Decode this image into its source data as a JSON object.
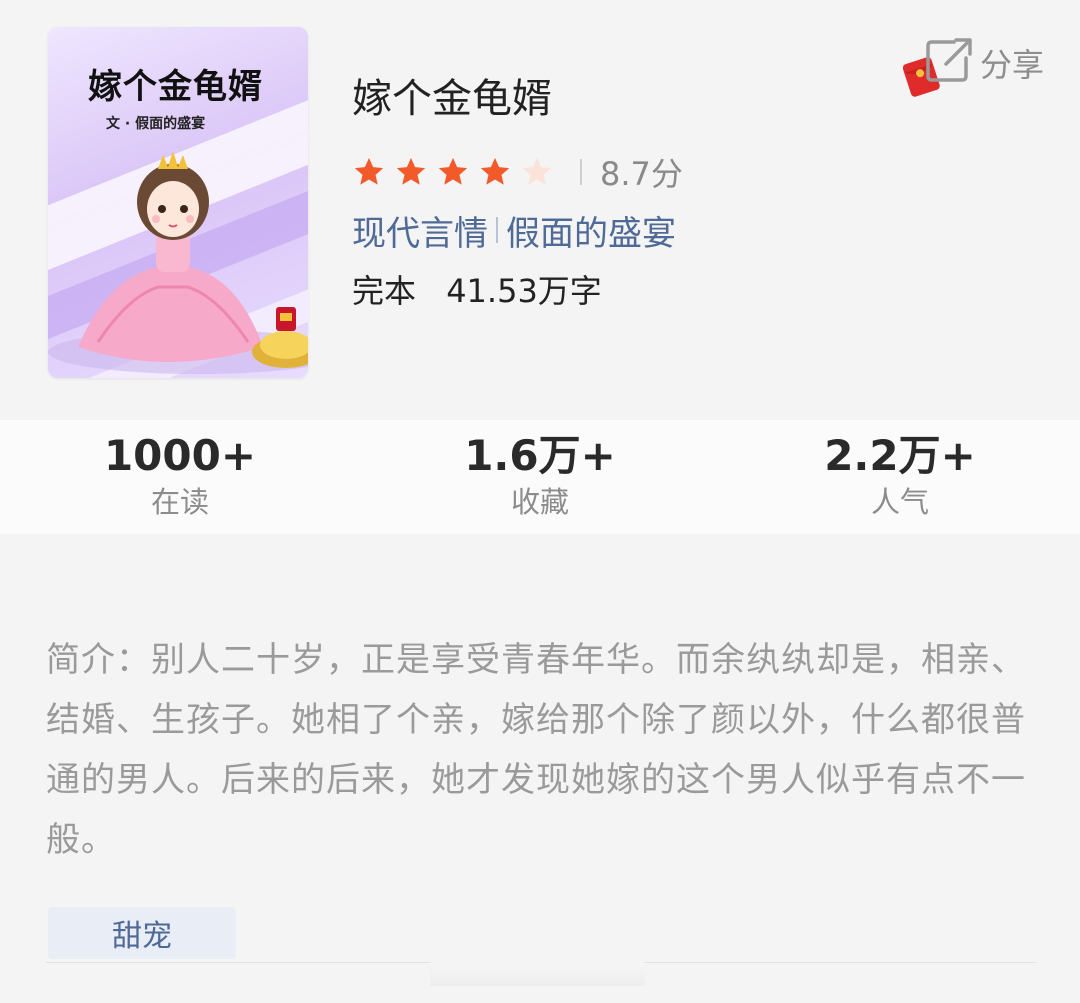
{
  "book": {
    "title": "嫁个金龟婿",
    "rating": 4,
    "rating_max": 5,
    "score": "8.7分",
    "category": "现代言情",
    "author": "假面的盛宴",
    "status": "完本",
    "word_count": "41.53万字"
  },
  "cover": {
    "title": "嫁个金龟婿",
    "author_line": "文 · 假面的盛宴"
  },
  "share": {
    "label": "分享"
  },
  "stats": [
    {
      "value": "1000+",
      "label": "在读"
    },
    {
      "value": "1.6万+",
      "label": "收藏"
    },
    {
      "value": "2.2万+",
      "label": "人气"
    }
  ],
  "intro": {
    "text": "简介：别人二十岁，正是享受青春年华。而余纨纨却是，相亲、结婚、生孩子。她相了个亲，嫁给那个除了颜以外，什么都很普通的男人。后来的后来，她才发现她嫁的这个男人似乎有点不一般。"
  },
  "tags": [
    "甜宠"
  ],
  "colors": {
    "star_filled": "#f25a2a",
    "star_empty": "#fbe3da",
    "link": "#4f6a96",
    "chip_bg": "#e9edf5"
  },
  "icons": {
    "share": "share-arrow-icon",
    "red_packet": "red-envelope-icon"
  }
}
